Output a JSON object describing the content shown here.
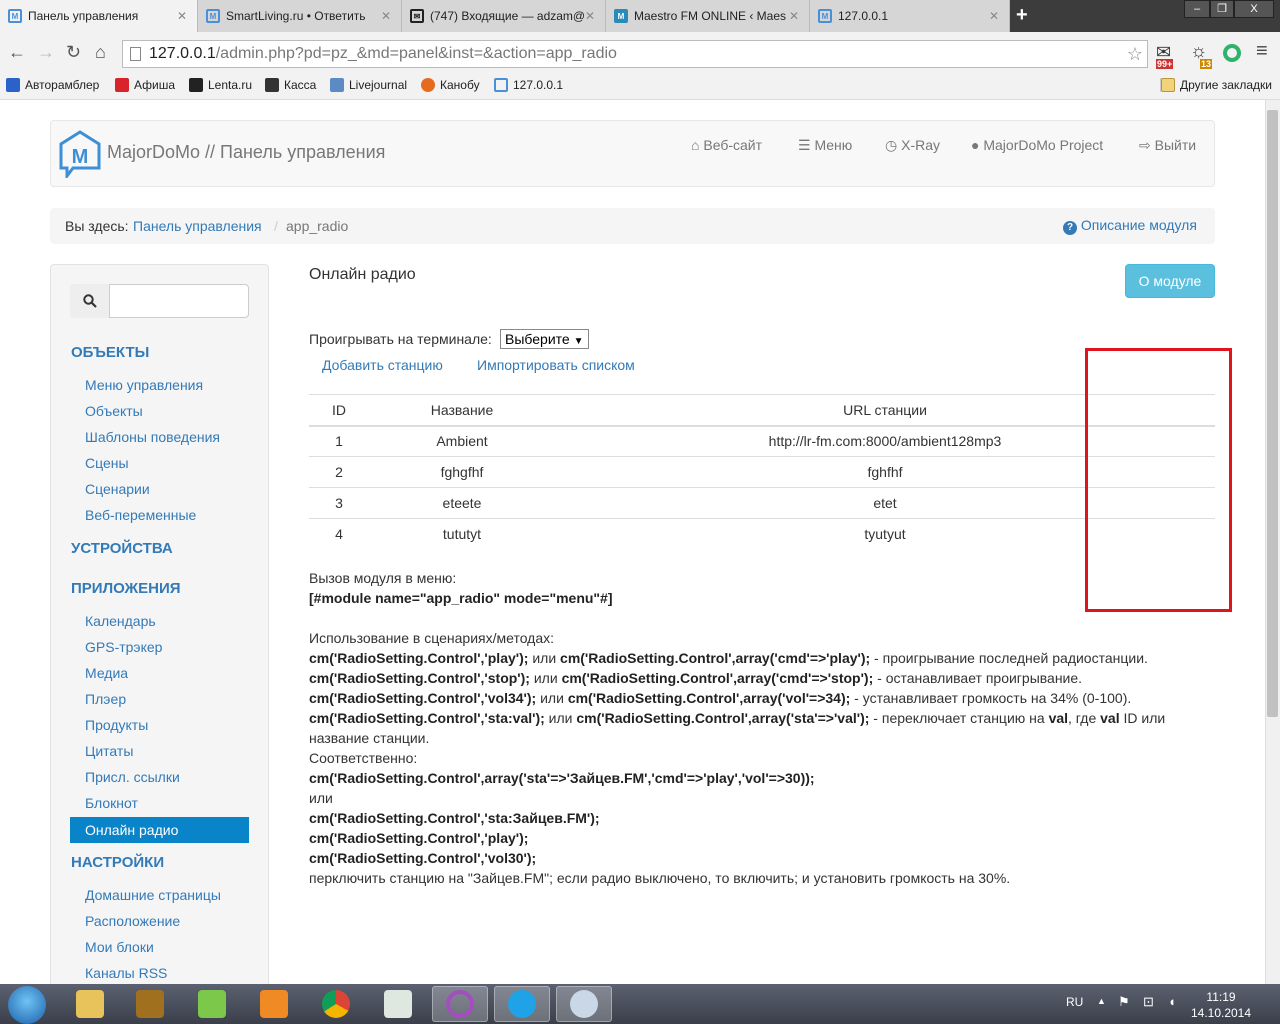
{
  "browser": {
    "tabs": [
      {
        "label": "Панель управления",
        "active": true
      },
      {
        "label": "SmartLiving.ru • Ответить"
      },
      {
        "label": "(747) Входящие — adzam@"
      },
      {
        "label": "Maestro FM ONLINE ‹ Maes"
      },
      {
        "label": "127.0.0.1"
      }
    ],
    "url_host": "127.0.0.1",
    "url_path": "/admin.php?pd=pz_&md=panel&inst=&action=app_radio",
    "ext_badges": [
      "99+",
      "13"
    ],
    "bookmarks": [
      "Авторамблер",
      "Афиша",
      "Lenta.ru",
      "Касса",
      "Livejournal",
      "Канобу",
      "127.0.0.1"
    ],
    "other_bookmarks": "Другие закладки"
  },
  "header": {
    "brand": "MajorDoMo // Панель управления",
    "nav": [
      "Веб-сайт",
      "Меню",
      "X-Ray",
      "MajorDoMo Project",
      "Выйти"
    ]
  },
  "breadcrumb": {
    "prefix": "Вы здесь:",
    "link": "Панель управления",
    "current": "app_radio",
    "help": "Описание модуля"
  },
  "sidebar": {
    "sections": [
      {
        "title": "ОБЪЕКТЫ",
        "items": [
          "Меню управления",
          "Объекты",
          "Шаблоны поведения",
          "Сцены",
          "Сценарии",
          "Веб-переменные"
        ]
      },
      {
        "title": "УСТРОЙСТВА",
        "items": []
      },
      {
        "title": "ПРИЛОЖЕНИЯ",
        "items": [
          "Календарь",
          "GPS-трэкер",
          "Медиа",
          "Плэер",
          "Продукты",
          "Цитаты",
          "Присл. ссылки",
          "Блокнот",
          "Онлайн радио"
        ]
      },
      {
        "title": "НАСТРОЙКИ",
        "items": [
          "Домашние страницы",
          "Расположение",
          "Мои блоки",
          "Каналы RSS"
        ]
      }
    ],
    "active": "Онлайн радио"
  },
  "main": {
    "title": "Онлайн радио",
    "about_button": "О модуле",
    "terminal_label": "Проигрывать на терминале:",
    "terminal_select": "Выберите",
    "add_station": "Добавить станцию",
    "import_list": "Импортировать списком",
    "table": {
      "headers": [
        "ID",
        "Название",
        "URL станции"
      ],
      "rows": [
        [
          "1",
          "Ambient",
          "http://lr-fm.com:8000/ambient128mp3"
        ],
        [
          "2",
          "fghgfhf",
          "fghfhf"
        ],
        [
          "3",
          "eteete",
          "etet"
        ],
        [
          "4",
          "tututyt",
          "tyutyut"
        ]
      ]
    },
    "menu_call_label": "Вызов модуля в меню:",
    "menu_call_code": "[#module name=\"app_radio\" mode=\"menu\"#]",
    "usage_label": "Использование в сценариях/методах:",
    "usage": [
      [
        {
          "b": 1,
          "t": "cm('RadioSetting.Control','play');"
        },
        {
          "t": " или "
        },
        {
          "b": 1,
          "t": "cm('RadioSetting.Control',array('cmd'=>'play');"
        },
        {
          "t": " - проигрывание последней радиостанции."
        }
      ],
      [
        {
          "b": 1,
          "t": "cm('RadioSetting.Control','stop');"
        },
        {
          "t": " или "
        },
        {
          "b": 1,
          "t": "cm('RadioSetting.Control',array('cmd'=>'stop');"
        },
        {
          "t": " - останавливает проигрывание."
        }
      ],
      [
        {
          "b": 1,
          "t": "cm('RadioSetting.Control','vol34');"
        },
        {
          "t": " или "
        },
        {
          "b": 1,
          "t": "cm('RadioSetting.Control',array('vol'=>34);"
        },
        {
          "t": " - устанавливает громкость на 34% (0-100)."
        }
      ],
      [
        {
          "b": 1,
          "t": "cm('RadioSetting.Control','sta:val');"
        },
        {
          "t": " или "
        },
        {
          "b": 1,
          "t": "cm('RadioSetting.Control',array('sta'=>'val');"
        },
        {
          "t": " - переключает станцию на "
        },
        {
          "b": 1,
          "t": "val"
        },
        {
          "t": ", где "
        },
        {
          "b": 1,
          "t": "val"
        },
        {
          "t": " ID или название станции."
        }
      ]
    ],
    "accordingly": "Соответственно:",
    "example1": "cm('RadioSetting.Control',array('sta'=>'Зайцев.FM','cmd'=>'play','vol'=>30));",
    "or": "или",
    "example2": [
      "cm('RadioSetting.Control','sta:Зайцев.FM');",
      "cm('RadioSetting.Control','play');",
      "cm('RadioSetting.Control','vol30');"
    ],
    "summary": "перключить станцию на \"Зайцев.FM\"; если радио выключено, то включить; и установить громкость на 30%."
  },
  "taskbar": {
    "lang": "RU",
    "time": "11:19",
    "date": "14.10.2014"
  },
  "colors": {
    "link": "#337ab7",
    "active_item": "#0a84c8",
    "about_button": "#5bc0de",
    "highlight_box": "#e0141e"
  }
}
